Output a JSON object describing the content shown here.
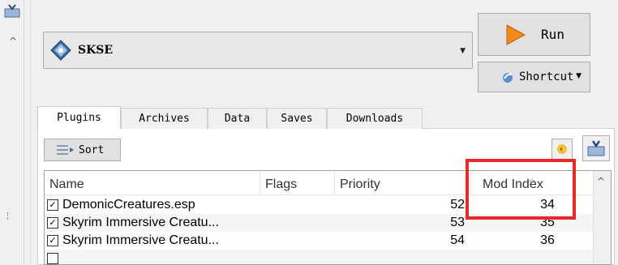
{
  "profile": {
    "selected": "SKSE"
  },
  "run_button": {
    "label": "Run"
  },
  "shortcut_button": {
    "label": "Shortcut"
  },
  "tabs": [
    {
      "label": "Plugins",
      "active": true
    },
    {
      "label": "Archives",
      "active": false
    },
    {
      "label": "Data",
      "active": false
    },
    {
      "label": "Saves",
      "active": false
    },
    {
      "label": "Downloads",
      "active": false
    }
  ],
  "toolbar": {
    "sort_label": "Sort"
  },
  "table": {
    "columns": [
      "Name",
      "Flags",
      "Priority",
      "Mod Index"
    ],
    "rows": [
      {
        "checked": true,
        "name": "DemonicCreatures.esp",
        "flags": "",
        "priority": "52",
        "mod_index": "34"
      },
      {
        "checked": true,
        "name": "Skyrim Immersive Creatu...",
        "flags": "",
        "priority": "53",
        "mod_index": "35"
      },
      {
        "checked": true,
        "name": "Skyrim Immersive Creatu...",
        "flags": "",
        "priority": "54",
        "mod_index": "36"
      }
    ]
  },
  "highlight_color": "#e8292a"
}
